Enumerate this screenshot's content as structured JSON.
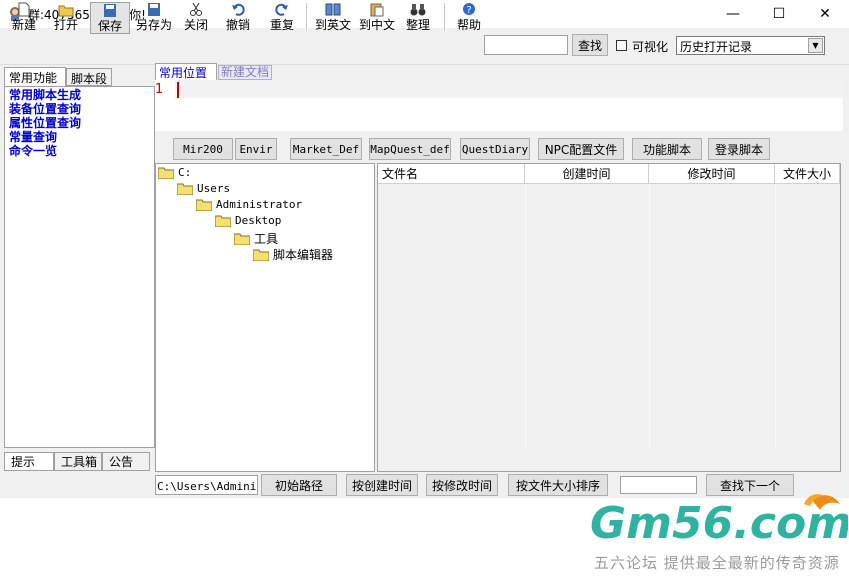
{
  "window": {
    "title": "群:40756588欢迎你!",
    "controls": [
      "—",
      "☐",
      "✕"
    ]
  },
  "toolbar": {
    "new": "新建",
    "open": "打开",
    "save": "保存",
    "save_as": "另存为",
    "close": "关闭",
    "undo": "撤销",
    "redo": "重复",
    "to_english": "到英文",
    "to_chinese": "到中文",
    "organize": "整理",
    "help": "帮助",
    "search_button": "查找",
    "search_value": "",
    "visualize_label": "可视化",
    "visualize_checked": false,
    "history_select": "历史打开记录"
  },
  "left_panel": {
    "tabs": [
      "常用功能",
      "脚本段"
    ],
    "items": [
      "常用脚本生成",
      "装备位置查询",
      "属性位置查询",
      "常量查询",
      "命令一览"
    ],
    "bottom_tabs": [
      "提示",
      "工具箱",
      "公告"
    ]
  },
  "editor": {
    "tabs": [
      "常用位置",
      "新建文档"
    ],
    "line_number": "1"
  },
  "file_buttons": [
    "Mir200",
    "Envir",
    "Market_Def",
    "MapQuest_def",
    "QuestDiary",
    "NPC配置文件",
    "功能脚本",
    "登录脚本"
  ],
  "tree": [
    "C:",
    "Users",
    "Administrator",
    "Desktop",
    "工具",
    "脚本编辑器"
  ],
  "file_list": {
    "columns": [
      "文件名",
      "创建时间",
      "修改时间",
      "文件大小"
    ]
  },
  "bottom_bar": {
    "path_value": "C:\\Users\\Administrator\\Desktop\\工具\\脚本编辑器",
    "initial_path": "初始路径",
    "sort_created": "按创建时间",
    "sort_modified": "按修改时间",
    "sort_size": "按文件大小排序",
    "find_value": "",
    "find_next": "查找下一个"
  },
  "watermark": {
    "logo": "Gm56.com",
    "tagline": "五六论坛 提供最全最新的传奇资源"
  }
}
